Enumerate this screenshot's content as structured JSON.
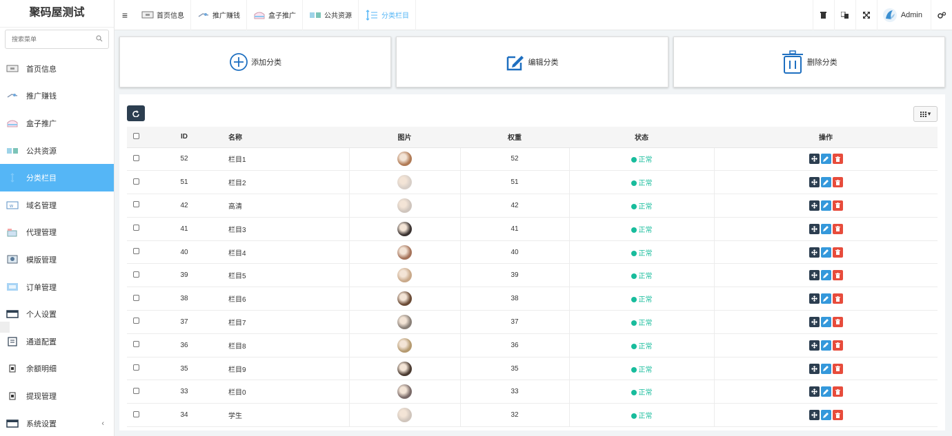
{
  "app": {
    "title": "聚码屋测试"
  },
  "search": {
    "placeholder": "搜索菜单"
  },
  "sidebar": {
    "items": [
      {
        "label": "首页信息",
        "icon": "monitor-icon",
        "active": false
      },
      {
        "label": "推广赚钱",
        "icon": "promo-icon",
        "active": false
      },
      {
        "label": "盒子推广",
        "icon": "box-icon",
        "active": false
      },
      {
        "label": "公共资源",
        "icon": "resource-icon",
        "active": false
      },
      {
        "label": "分类栏目",
        "icon": "category-icon",
        "active": true
      },
      {
        "label": "域名管理",
        "icon": "domain-icon",
        "active": false
      },
      {
        "label": "代理管理",
        "icon": "agent-icon",
        "active": false
      },
      {
        "label": "模版管理",
        "icon": "template-icon",
        "active": false
      },
      {
        "label": "订单管理",
        "icon": "order-icon",
        "active": false
      },
      {
        "label": "个人设置",
        "icon": "personal-icon",
        "active": false
      },
      {
        "label": "通道配置",
        "icon": "channel-icon",
        "active": false
      },
      {
        "label": "余额明细",
        "icon": "balance-icon",
        "active": false
      },
      {
        "label": "提现管理",
        "icon": "withdraw-icon",
        "active": false
      },
      {
        "label": "系统设置",
        "icon": "system-icon",
        "active": false
      }
    ]
  },
  "topnav": {
    "tabs": [
      {
        "label": "首页信息",
        "icon": "monitor-icon"
      },
      {
        "label": "推广赚钱",
        "icon": "promo-icon"
      },
      {
        "label": "盒子推广",
        "icon": "box-icon"
      },
      {
        "label": "公共资源",
        "icon": "resource-icon"
      },
      {
        "label": "分类栏目",
        "icon": "category-icon"
      }
    ],
    "user": "Admin"
  },
  "actions": {
    "add": "添加分类",
    "edit": "编辑分类",
    "delete": "删除分类"
  },
  "table": {
    "headers": {
      "id": "ID",
      "name": "名称",
      "image": "图片",
      "weight": "权重",
      "status": "状态",
      "ops": "操作"
    },
    "rows": [
      {
        "id": "52",
        "name": "栏目1",
        "weight": "52",
        "status": "正常"
      },
      {
        "id": "51",
        "name": "栏目2",
        "weight": "51",
        "status": "正常"
      },
      {
        "id": "42",
        "name": "高清",
        "weight": "42",
        "status": "正常"
      },
      {
        "id": "41",
        "name": "栏目3",
        "weight": "41",
        "status": "正常"
      },
      {
        "id": "40",
        "name": "栏目4",
        "weight": "40",
        "status": "正常"
      },
      {
        "id": "39",
        "name": "栏目5",
        "weight": "39",
        "status": "正常"
      },
      {
        "id": "38",
        "name": "栏目6",
        "weight": "38",
        "status": "正常"
      },
      {
        "id": "37",
        "name": "栏目7",
        "weight": "37",
        "status": "正常"
      },
      {
        "id": "36",
        "name": "栏目8",
        "weight": "36",
        "status": "正常"
      },
      {
        "id": "35",
        "name": "栏目9",
        "weight": "35",
        "status": "正常"
      },
      {
        "id": "33",
        "name": "栏目0",
        "weight": "33",
        "status": "正常"
      },
      {
        "id": "34",
        "name": "学生",
        "weight": "32",
        "status": "正常"
      }
    ]
  },
  "colors": {
    "accent": "#55b6f6",
    "dark": "#2c3e50",
    "info": "#3498db",
    "danger": "#e74c3c",
    "success": "#18bc9c"
  }
}
